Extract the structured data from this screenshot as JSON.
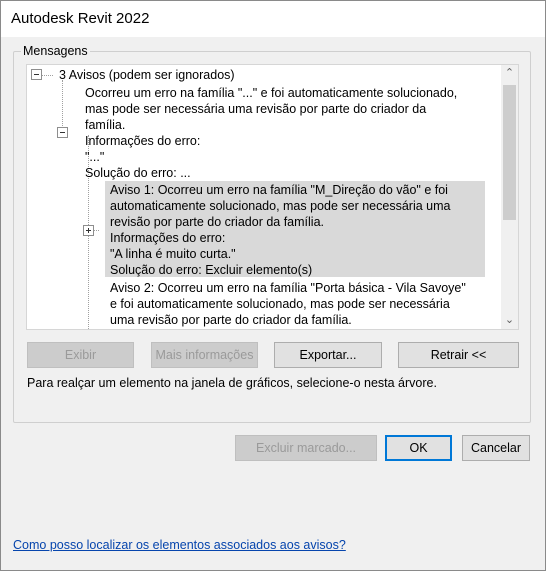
{
  "window": {
    "title": "Autodesk Revit 2022"
  },
  "messages": {
    "legend": "Mensagens",
    "tree": {
      "root": "3 Avisos (podem ser ignorados)",
      "root_desc": [
        "Ocorreu um erro na família \"...\" e foi automaticamente solucionado,",
        "mas pode ser necessária uma revisão por parte do criador da",
        "família."
      ],
      "info_label": "Informações do erro:",
      "info_value": "\"...\"",
      "solution": "Solução do erro: ...",
      "warning1": [
        "Aviso 1: Ocorreu um erro na família \"M_Direção do vão\" e foi",
        "automaticamente solucionado, mas pode ser necessária uma",
        "revisão por parte do criador da família.",
        "Informações do erro:",
        "\"A linha é muito curta.\"",
        "Solução do erro: Excluir elemento(s)"
      ],
      "warning2": [
        "Aviso 2: Ocorreu um erro na família \"Porta básica - Vila Savoye\"",
        "e foi automaticamente solucionado, mas pode ser necessária",
        "uma revisão por parte do criador da família."
      ]
    },
    "buttons": {
      "show": "Exibir",
      "more_info": "Mais informações",
      "export": "Exportar...",
      "collapse": "Retrair <<"
    },
    "hint": "Para realçar um elemento na janela de gráficos, selecione-o nesta árvore."
  },
  "footer": {
    "delete_checked": "Excluir marcado...",
    "ok": "OK",
    "cancel": "Cancelar",
    "help_link": "Como posso localizar os elementos associados aos avisos?"
  }
}
